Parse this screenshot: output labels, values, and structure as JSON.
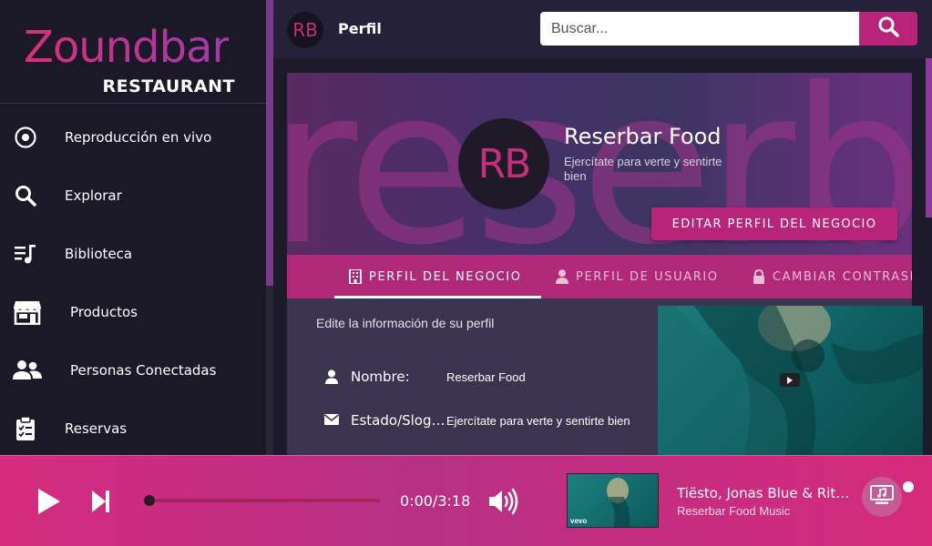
{
  "brand": {
    "name": "Zoundbar",
    "sub": "RESTAURANT"
  },
  "sidebar": {
    "items": [
      {
        "label": "Reproducción en vivo",
        "icon": "live-radio-icon"
      },
      {
        "label": "Explorar",
        "icon": "search-icon"
      },
      {
        "label": "Biblioteca",
        "icon": "music-library-icon"
      },
      {
        "label": "Productos",
        "icon": "store-icon"
      },
      {
        "label": "Personas Conectadas",
        "icon": "people-icon"
      },
      {
        "label": "Reservas",
        "icon": "clipboard-check-icon"
      }
    ]
  },
  "header": {
    "avatar_initials": "RB",
    "title": "Perfil",
    "search_placeholder": "Buscar..."
  },
  "profile": {
    "bg_word": "reserba",
    "avatar_initials": "RB",
    "name": "Reserbar Food",
    "slogan": "Ejercítate para verte y sentirte bien",
    "edit_button": "EDITAR PERFIL DEL NEGOCIO"
  },
  "tabs": [
    {
      "label": "PERFIL DEL NEGOCIO",
      "active": true,
      "icon": "building-icon"
    },
    {
      "label": "PERFIL DE USUARIO",
      "active": false,
      "icon": "user-icon"
    },
    {
      "label": "CAMBIAR CONTRASEÑA",
      "active": false,
      "icon": "lock-icon"
    }
  ],
  "form": {
    "hint": "Edite la información de su perfil",
    "fields": [
      {
        "label": "Nombre:",
        "value": "Reserbar Food",
        "icon": "user-icon"
      },
      {
        "label": "Estado/Slogan:",
        "value": "Ejercítate para verte y sentirte bien",
        "icon": "envelope-icon"
      }
    ]
  },
  "player": {
    "time": "0:00/3:18",
    "progress": 0,
    "track_title": "Tiësto, Jonas Blue & Rita Ora",
    "track_artist": "Reserbar Food Music",
    "thumb_logo": "vevo"
  },
  "colors": {
    "accent": "#b8247a",
    "sidebar_bg": "#1b1828",
    "player_bg": "#d52b7e"
  }
}
